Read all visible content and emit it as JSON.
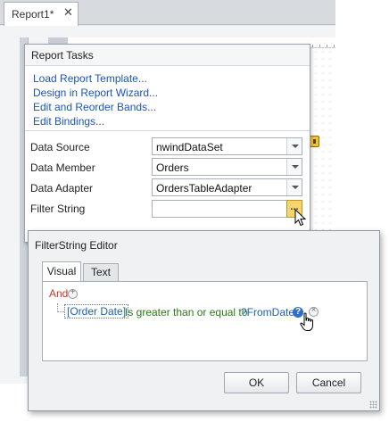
{
  "document_tab": {
    "label": "Report1*",
    "close_glyph": "✕"
  },
  "report_tasks": {
    "title": "Report Tasks",
    "links": [
      "Load Report Template...",
      "Design in Report Wizard...",
      "Edit and Reorder Bands...",
      "Edit Bindings..."
    ],
    "properties": {
      "data_source": {
        "label": "Data Source",
        "value": "nwindDataSet"
      },
      "data_member": {
        "label": "Data Member",
        "value": "Orders"
      },
      "data_adapter": {
        "label": "Data Adapter",
        "value": "OrdersTableAdapter"
      },
      "filter_string": {
        "label": "Filter String",
        "value": "",
        "button_label": "..."
      }
    }
  },
  "filter_editor": {
    "title": "FilterString Editor",
    "tabs": {
      "visual": "Visual",
      "text": "Text"
    },
    "group_operator": "And",
    "condition": {
      "field": "[Order Date]",
      "operator": "Is greater than or equal to",
      "parameter": "?FromDate"
    },
    "ok_label": "OK",
    "cancel_label": "Cancel"
  },
  "colors": {
    "link": "#1a55b8",
    "group_operator": "#c0392b",
    "operator": "#2a7a16",
    "field": "#1f5fb3",
    "ellipsis_button": "#f6d46e"
  },
  "icons": [
    "close-icon",
    "smart-tag-icon",
    "dropdown-arrow-icon",
    "add-condition-icon",
    "parameter-help-icon",
    "remove-condition-icon",
    "arrow-cursor-icon",
    "hand-cursor-icon",
    "resize-grip-icon"
  ]
}
